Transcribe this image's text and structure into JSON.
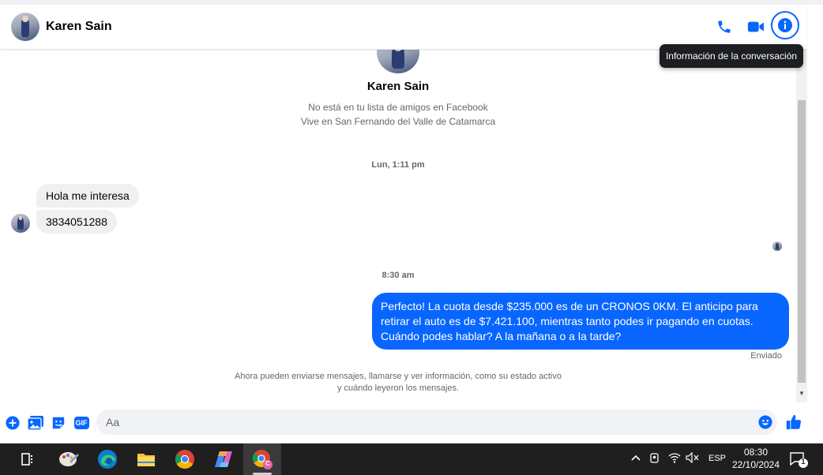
{
  "header": {
    "contact_name": "Karen Sain",
    "tooltip": "Información de la conversación",
    "icons": [
      "phone-icon",
      "video-camera-icon",
      "info-icon"
    ]
  },
  "profile": {
    "name": "Karen Sain",
    "friend_status": "No está en tu lista de amigos en Facebook",
    "location": "Vive en San Fernando del Valle de Catamarca"
  },
  "messages": {
    "time_1": "Lun, 1:11 pm",
    "incoming": [
      "Hola me interesa",
      "3834051288"
    ],
    "time_2": "8:30 am",
    "outgoing": "Perfecto! La cuota desde $235.000 es de un CRONOS 0KM. El anticipo para retirar el auto es de $7.421.100, mientras tanto podes ir pagando en cuotas. Cuándo podes hablar? A la mañana o a la tarde?",
    "status": "Enviado",
    "note_line1": "Ahora pueden enviarse mensajes, llamarse y ver información, como su estado activo",
    "note_line2": "y cuándo leyeron los mensajes."
  },
  "composer": {
    "placeholder": "Aa",
    "gif_label": "GIF",
    "icons": [
      "plus-icon",
      "photo-icon",
      "sticker-icon",
      "gif-icon",
      "emoji-icon",
      "like-icon"
    ]
  },
  "taskbar": {
    "language": "ESP",
    "time": "08:30",
    "date": "22/10/2024",
    "notification_count": "1",
    "chrome_profile_badge": "C",
    "apps": [
      "task-view-icon",
      "paint-icon",
      "edge-icon",
      "file-explorer-icon",
      "chrome-icon",
      "copilot-icon",
      "chrome-profile-icon"
    ]
  },
  "colors": {
    "accent": "#0866ff",
    "bubble_in": "#f0f0f0",
    "taskbar": "#1f1f1f"
  }
}
